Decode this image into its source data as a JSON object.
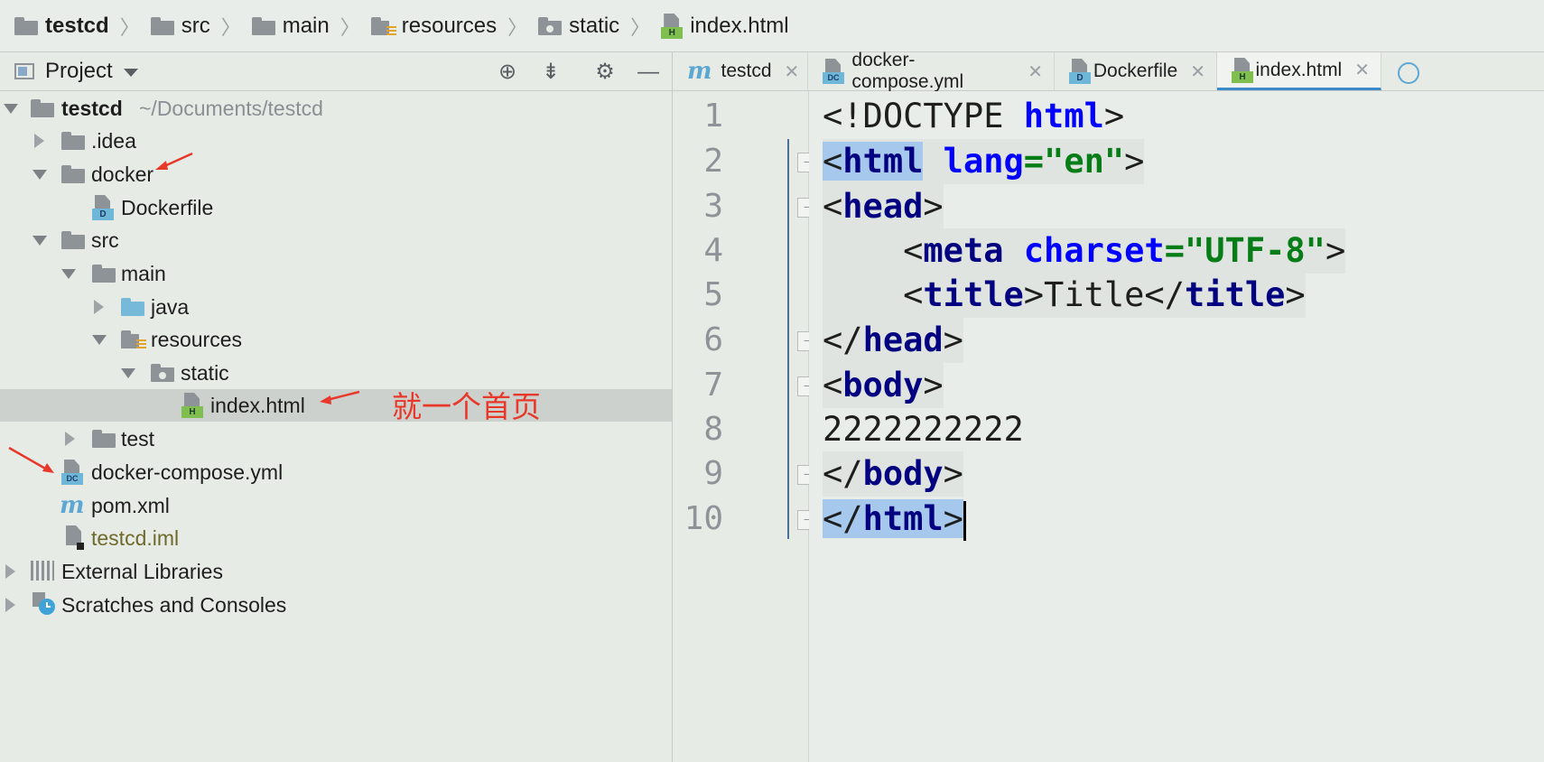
{
  "breadcrumb": [
    {
      "label": "testcd",
      "icon": "project-folder-icon",
      "bold": true
    },
    {
      "label": "src",
      "icon": "folder-icon"
    },
    {
      "label": "main",
      "icon": "folder-icon"
    },
    {
      "label": "resources",
      "icon": "resources-folder-icon"
    },
    {
      "label": "static",
      "icon": "static-folder-icon"
    },
    {
      "label": "index.html",
      "icon": "html-file-icon"
    }
  ],
  "project_panel": {
    "title": "Project",
    "tree": [
      {
        "label": "testcd",
        "extra": "~/Documents/testcd",
        "icon": "project-folder-icon",
        "expanded": true
      },
      {
        "label": ".idea",
        "icon": "folder-icon",
        "expanded": false
      },
      {
        "label": "docker",
        "icon": "folder-icon",
        "expanded": true
      },
      {
        "label": "Dockerfile",
        "icon": "dockerfile-icon"
      },
      {
        "label": "src",
        "icon": "folder-icon",
        "expanded": true
      },
      {
        "label": "main",
        "icon": "folder-icon",
        "expanded": true
      },
      {
        "label": "java",
        "icon": "source-folder-icon",
        "expanded": false
      },
      {
        "label": "resources",
        "icon": "resources-folder-icon",
        "expanded": true
      },
      {
        "label": "static",
        "icon": "static-folder-icon",
        "expanded": true
      },
      {
        "label": "index.html",
        "icon": "html-file-icon",
        "selected": true
      },
      {
        "label": "test",
        "icon": "folder-icon",
        "expanded": false
      },
      {
        "label": "docker-compose.yml",
        "icon": "docker-compose-icon"
      },
      {
        "label": "pom.xml",
        "icon": "maven-icon"
      },
      {
        "label": "testcd.iml",
        "icon": "iml-file-icon"
      },
      {
        "label": "External Libraries",
        "icon": "libraries-icon",
        "expanded": false
      },
      {
        "label": "Scratches and Consoles",
        "icon": "scratches-icon",
        "expanded": false
      }
    ]
  },
  "annotation": {
    "text": "就一个首页",
    "color": "#e8382a"
  },
  "editor": {
    "tabs": [
      {
        "label": "testcd",
        "icon": "maven-icon"
      },
      {
        "label": "docker-compose.yml",
        "icon": "docker-compose-icon"
      },
      {
        "label": "Dockerfile",
        "icon": "dockerfile-icon"
      },
      {
        "label": "index.html",
        "icon": "html-file-icon",
        "active": true
      }
    ],
    "line_numbers": [
      "1",
      "2",
      "3",
      "4",
      "5",
      "6",
      "7",
      "8",
      "9",
      "10"
    ],
    "code": {
      "l1": [
        "<!DOCTYPE ",
        "html",
        ">"
      ],
      "l2": [
        "<",
        "html",
        " ",
        "lang",
        "=",
        "\"en\"",
        ">"
      ],
      "l3": [
        "<",
        "head",
        ">"
      ],
      "l4": [
        "    <",
        "meta",
        " ",
        "charset",
        "=",
        "\"UTF-8\"",
        ">"
      ],
      "l5": [
        "    <",
        "title",
        ">Title</",
        "title",
        ">"
      ],
      "l6": [
        "</",
        "head",
        ">"
      ],
      "l7": [
        "<",
        "body",
        ">"
      ],
      "l8": [
        "2222222222"
      ],
      "l9": [
        "</",
        "body",
        ">"
      ],
      "l10": [
        "</",
        "html",
        ">"
      ]
    }
  },
  "colors": {
    "accent": "#3c8ac8",
    "tag": "#000080",
    "attr": "#0000ff",
    "string": "#067d17"
  }
}
